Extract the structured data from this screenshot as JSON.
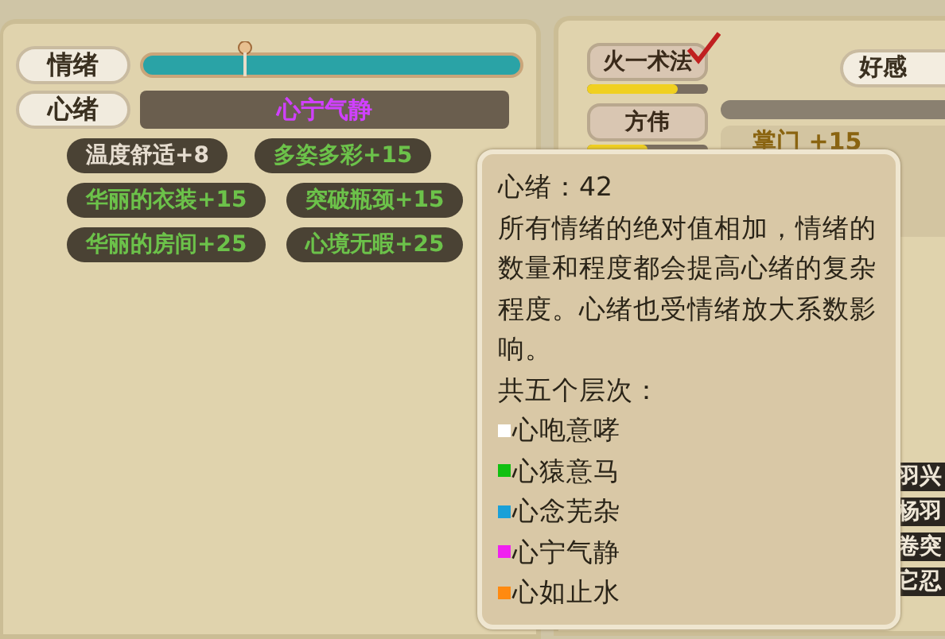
{
  "emotion_panel": {
    "emotion_label": "情绪",
    "level": 0.27,
    "mood_label": "心绪",
    "mood_value": "心宁气静"
  },
  "tags": [
    {
      "text": "温度舒适+8",
      "kind": "neutral"
    },
    {
      "text": "多姿多彩+15",
      "kind": "positive"
    },
    {
      "text": "华丽的衣装+15",
      "kind": "positive"
    },
    {
      "text": "突破瓶颈+15",
      "kind": "positive"
    },
    {
      "text": "华丽的房间+25",
      "kind": "positive"
    },
    {
      "text": "心境无暇+25",
      "kind": "positive"
    }
  ],
  "characters": [
    {
      "name": "火一术法",
      "checked": true,
      "level": 0.75
    },
    {
      "name": "方伟",
      "checked": false,
      "level": 0.5
    }
  ],
  "favor_label": "好感",
  "sect_bonus": "掌门 +15",
  "names": [
    "羽兴",
    "杨羽",
    "卷突",
    "它忍"
  ],
  "tooltip": {
    "title": "心绪：42",
    "description": "所有情绪的绝对值相加，情绪的数量和程度都会提高心绪的复杂程度。心绪也受情绪放大系数影响。",
    "levels_heading": "共五个层次：",
    "levels": [
      {
        "name": "心咆意哮",
        "color": "#ffffff"
      },
      {
        "name": "心猿意马",
        "color": "#10c010"
      },
      {
        "name": "心念芜杂",
        "color": "#1aa0d8"
      },
      {
        "name": "心宁气静",
        "color": "#f020f0"
      },
      {
        "name": "心如止水",
        "color": "#ff8a10"
      }
    ]
  }
}
